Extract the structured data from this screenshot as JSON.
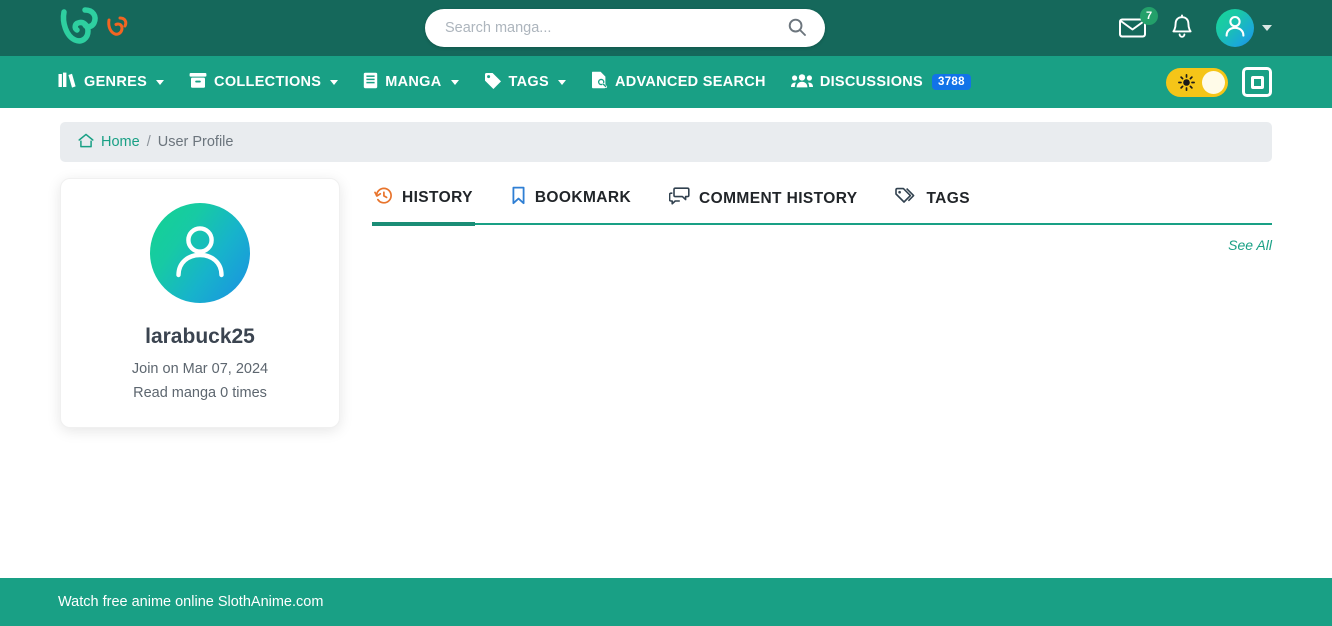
{
  "colors": {
    "header_dark": "#15685b",
    "header_light": "#19a085",
    "accent_teal": "#19a085",
    "badge_blue": "#1273e8",
    "badge_green": "#23a06a",
    "toggle_yellow": "#f5c518",
    "breadcrumb_bg": "#e9ecef",
    "logo_orange": "#f26522"
  },
  "topbar": {
    "logo_name": "vine-logo",
    "logo_secondary_name": "vine-logo-small",
    "search": {
      "placeholder": "Search manga...",
      "value": "",
      "button_icon": "search-icon"
    },
    "messages": {
      "icon": "envelope-icon",
      "badge": "7"
    },
    "notifications": {
      "icon": "bell-icon"
    },
    "account": {
      "icon": "user-avatar-icon",
      "caret": "chevron-down-icon"
    }
  },
  "navbar": {
    "items": [
      {
        "label": "GENRES",
        "icon": "books-icon",
        "has_caret": true
      },
      {
        "label": "COLLECTIONS",
        "icon": "archive-box-icon",
        "has_caret": true
      },
      {
        "label": "MANGA",
        "icon": "book-icon",
        "has_caret": true
      },
      {
        "label": "TAGS",
        "icon": "tag-icon",
        "has_caret": true
      },
      {
        "label": "ADVANCED SEARCH",
        "icon": "file-search-icon",
        "has_caret": false
      },
      {
        "label": "DISCUSSIONS",
        "icon": "users-icon",
        "has_caret": false,
        "badge": "3788"
      }
    ],
    "theme_toggle": {
      "name": "theme-toggle",
      "icon": "sun-icon",
      "state": "light"
    },
    "layout_button": {
      "name": "layout-toggle-button",
      "icon": "square-icon"
    }
  },
  "breadcrumb": {
    "home_icon": "home-icon",
    "home_label": "Home",
    "separator": "/",
    "current": "User Profile"
  },
  "profile": {
    "avatar_icon": "user-avatar-icon",
    "username": "larabuck25",
    "join_text": "Join on Mar 07, 2024",
    "read_text": "Read manga 0 times"
  },
  "tabs": [
    {
      "label": "HISTORY",
      "icon": "clock-rotate-left-icon",
      "active": true
    },
    {
      "label": "BOOKMARK",
      "icon": "bookmark-icon",
      "active": false
    },
    {
      "label": "COMMENT HISTORY",
      "icon": "comments-icon",
      "active": false
    },
    {
      "label": "TAGS",
      "icon": "tags-icon",
      "active": false
    }
  ],
  "panel": {
    "see_all_label": "See All",
    "content": ""
  },
  "footer": {
    "text": "Watch free anime online SlothAnime.com"
  }
}
